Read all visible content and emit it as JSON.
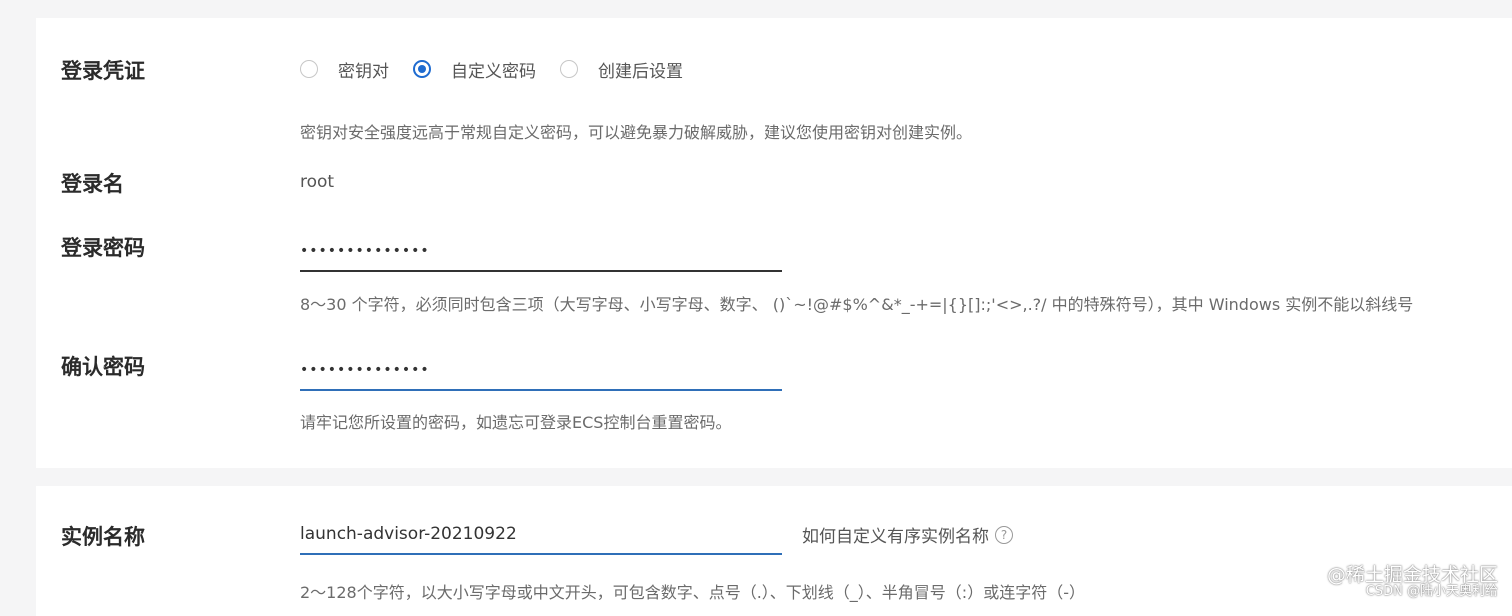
{
  "login_credential": {
    "label": "登录凭证",
    "options": [
      {
        "label": "密钥对",
        "selected": false
      },
      {
        "label": "自定义密码",
        "selected": true
      },
      {
        "label": "创建后设置",
        "selected": false
      }
    ],
    "hint": "密钥对安全强度远高于常规自定义密码，可以避免暴力破解威胁，建议您使用密钥对创建实例。"
  },
  "login_name": {
    "label": "登录名",
    "value": "root"
  },
  "login_password": {
    "label": "登录密码",
    "value": "••••••••••••••",
    "hint": "8～30 个字符，必须同时包含三项（大写字母、小写字母、数字、 ()`~!@#$%^&*_-+=|{}[]:;'<>,.?/ 中的特殊符号），其中 Windows 实例不能以斜线号"
  },
  "confirm_password": {
    "label": "确认密码",
    "value": "••••••••••••••",
    "hint": "请牢记您所设置的密码，如遗忘可登录ECS控制台重置密码。"
  },
  "instance_name": {
    "label": "实例名称",
    "value": "launch-advisor-20210922",
    "help_link": "如何自定义有序实例名称",
    "hint": "2～128个字符，以大小写字母或中文开头，可包含数字、点号（.）、下划线（_）、半角冒号（:）或连字符（-）"
  },
  "watermark": {
    "line1": "@稀土掘金技术社区",
    "line2": "CSDN @陆小天奥利给"
  },
  "colors": {
    "accent": "#1e6bd0",
    "input_underline_focus": "#2f6fb8",
    "background": "#f5f5f6"
  }
}
